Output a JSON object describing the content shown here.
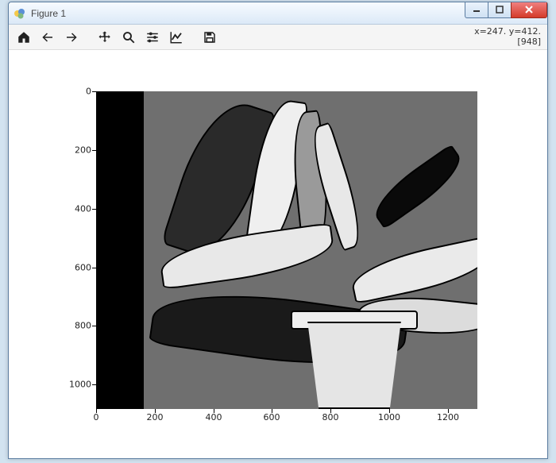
{
  "window": {
    "title": "Figure 1"
  },
  "toolbar": {
    "home": "Home",
    "back": "Back",
    "forward": "Forward",
    "pan": "Pan",
    "zoom": "Zoom",
    "subplots": "Configure subplots",
    "edit": "Edit axis",
    "save": "Save"
  },
  "status": {
    "coords": "x=247. y=412.",
    "value": "[948]"
  },
  "chart_data": {
    "type": "image",
    "description": "Grayscale posterized image of a potted aloe-like plant",
    "x_ticks": [
      "0",
      "200",
      "400",
      "600",
      "800",
      "1000",
      "1200"
    ],
    "y_ticks": [
      "0",
      "200",
      "400",
      "600",
      "800",
      "1000"
    ],
    "x_range": [
      0,
      1300
    ],
    "y_range": [
      0,
      1083
    ],
    "y_inverted": true,
    "cursor": {
      "x": 247,
      "y": 412,
      "pixel_value": 948
    }
  }
}
